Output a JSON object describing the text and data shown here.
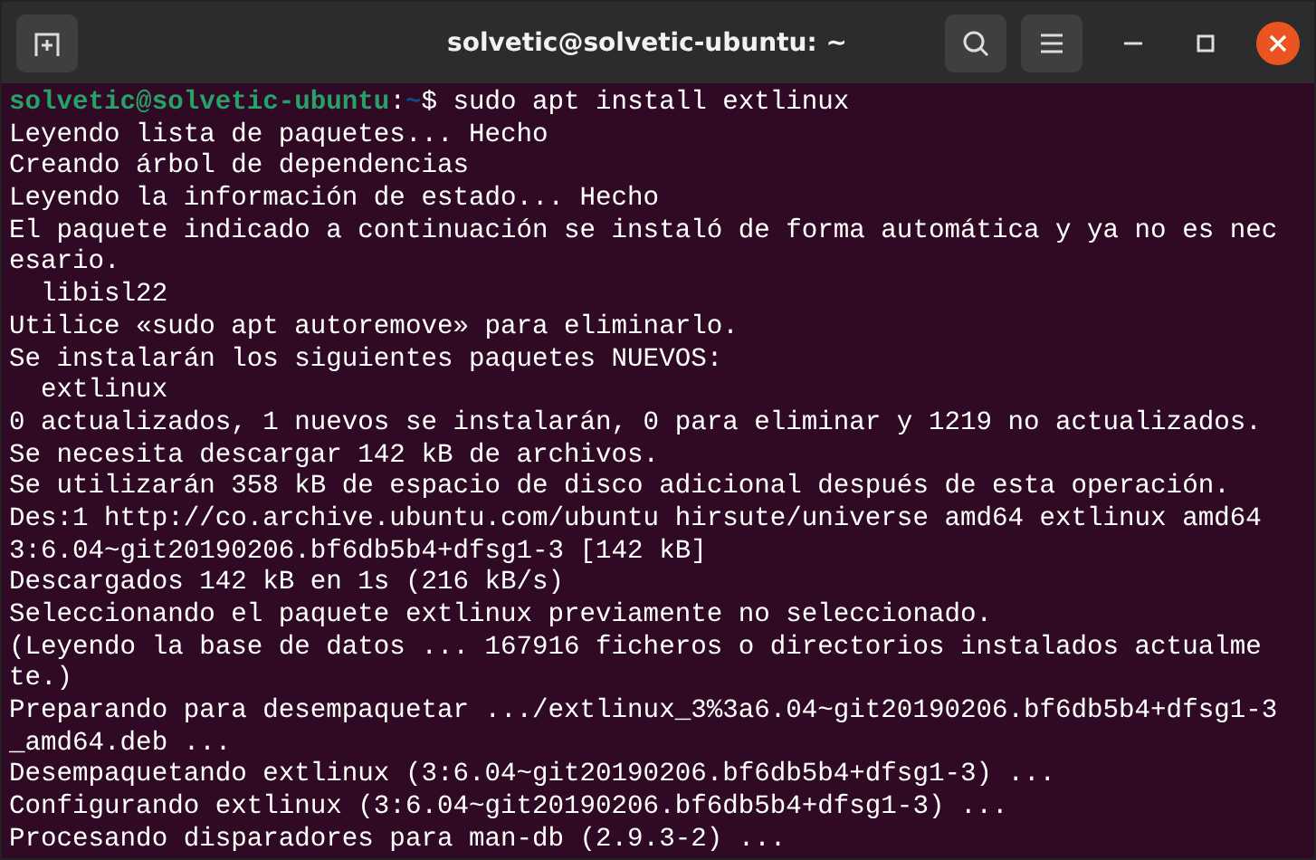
{
  "window": {
    "title": "solvetic@solvetic-ubuntu: ~"
  },
  "prompt": {
    "user_host": "solvetic@solvetic-ubuntu",
    "separator": ":",
    "path": "~",
    "command": "$ sudo apt install extlinux"
  },
  "output_lines": [
    "Leyendo lista de paquetes... Hecho",
    "Creando árbol de dependencias",
    "Leyendo la información de estado... Hecho",
    "El paquete indicado a continuación se instaló de forma automática y ya no es nec",
    "esario.",
    "  libisl22",
    "Utilice «sudo apt autoremove» para eliminarlo.",
    "Se instalarán los siguientes paquetes NUEVOS:",
    "  extlinux",
    "0 actualizados, 1 nuevos se instalarán, 0 para eliminar y 1219 no actualizados.",
    "Se necesita descargar 142 kB de archivos.",
    "Se utilizarán 358 kB de espacio de disco adicional después de esta operación.",
    "Des:1 http://co.archive.ubuntu.com/ubuntu hirsute/universe amd64 extlinux amd64",
    "3:6.04~git20190206.bf6db5b4+dfsg1-3 [142 kB]",
    "Descargados 142 kB en 1s (216 kB/s)",
    "Seleccionando el paquete extlinux previamente no seleccionado.",
    "(Leyendo la base de datos ... 167916 ficheros o directorios instalados actualme",
    "te.)",
    "Preparando para desempaquetar .../extlinux_3%3a6.04~git20190206.bf6db5b4+dfsg1-3",
    "_amd64.deb ...",
    "Desempaquetando extlinux (3:6.04~git20190206.bf6db5b4+dfsg1-3) ...",
    "Configurando extlinux (3:6.04~git20190206.bf6db5b4+dfsg1-3) ...",
    "Procesando disparadores para man-db (2.9.3-2) ..."
  ]
}
